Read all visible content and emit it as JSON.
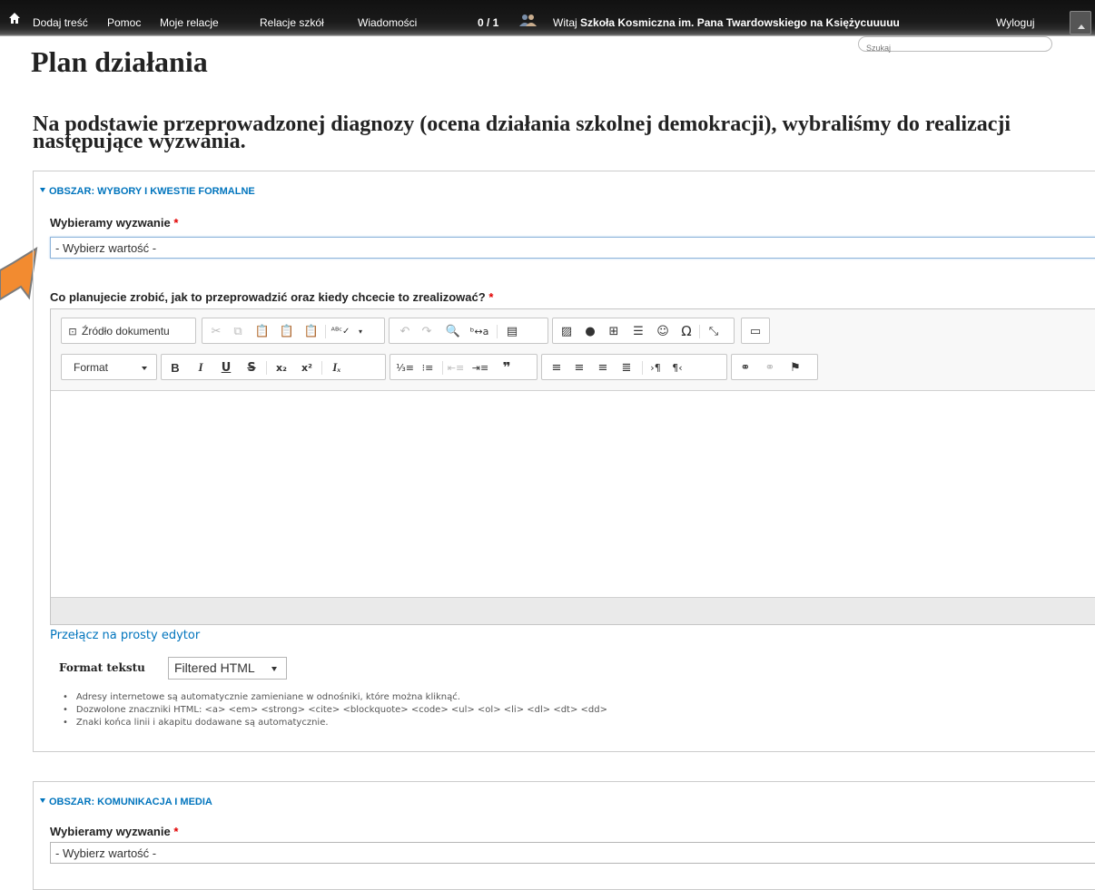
{
  "toolbar": {
    "items": [
      "Dodaj treść",
      "Pomoc",
      "Moje relacje",
      "Relacje szkół",
      "Wiadomości"
    ],
    "counter": "0 / 1",
    "welcome": "Witaj",
    "school": "Szkoła Kosmiczna im. Pana Twardowskiego na Księżycuuuuu",
    "logout": "Wyloguj",
    "search_placeholder": "Szukaj"
  },
  "page": {
    "title": "Plan działania",
    "intro": "Na podstawie przeprowadzonej diagnozy (ocena działania szkolnej demokracji), wybraliśmy do realizacji następujące wyzwania."
  },
  "section1": {
    "legend": "OBSZAR: WYBORY I KWESTIE FORMALNE",
    "challenge_label": "Wybieramy wyzwanie",
    "challenge_value": "- Wybierz wartość -",
    "plan_label": "Co planujecie zrobić, jak to przeprowadzić oraz kiedy chcecie to zrealizować?",
    "required_mark": "*"
  },
  "editor": {
    "source_label": "Źródło dokumentu",
    "format_label": "Format",
    "switch_link": "Przełącz na prosty edytor"
  },
  "text_format": {
    "label": "Format tekstu",
    "value": "Filtered HTML",
    "tips": [
      "Adresy internetowe są automatycznie zamieniane w odnośniki, które można kliknąć.",
      "Dozwolone znaczniki HTML: <a> <em> <strong> <cite> <blockquote> <code> <ul> <ol> <li> <dl> <dt> <dd>",
      "Znaki końca linii i akapitu dodawane są automatycznie."
    ]
  },
  "section2": {
    "legend": "OBSZAR: KOMUNIKACJA I MEDIA",
    "challenge_label": "Wybieramy wyzwanie",
    "challenge_value": "- Wybierz wartość -",
    "required_mark": "*"
  },
  "colors": {
    "link": "#0074bd",
    "required": "#e10000",
    "arrow": "#f28b30"
  },
  "icons": [
    "home-icon",
    "people-icon",
    "shortcuts-toggle-icon"
  ]
}
